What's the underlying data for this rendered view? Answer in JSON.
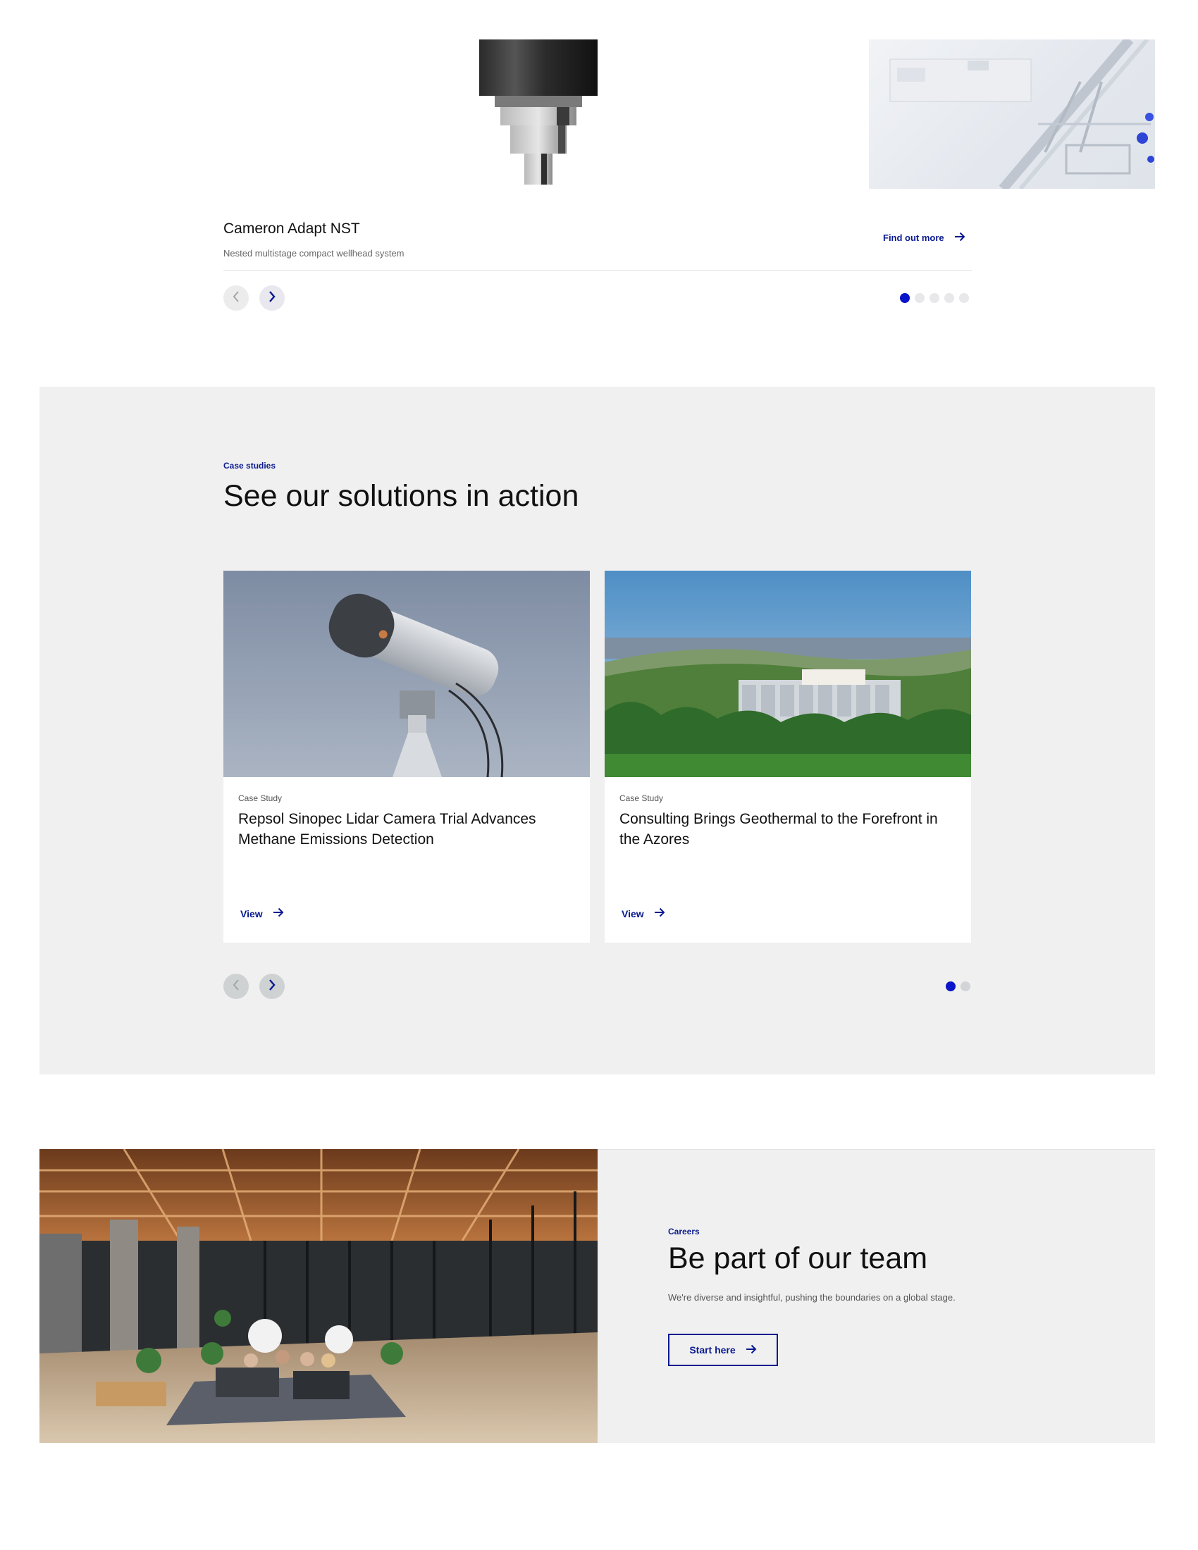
{
  "product_carousel": {
    "title": "Cameron Adapt NST",
    "subtitle": "Nested multistage compact wellhead system",
    "cta_label": "Find out more",
    "slide_count": 5,
    "active_slide": 1
  },
  "case_studies": {
    "eyebrow": "Case studies",
    "heading": "See our solutions in action",
    "cards": [
      {
        "tag": "Case Study",
        "title": "Repsol Sinopec Lidar Camera Trial Advances Methane Emissions Detection",
        "link_label": "View"
      },
      {
        "tag": "Case Study",
        "title": "Consulting Brings Geothermal to the Forefront in the Azores",
        "link_label": "View"
      }
    ],
    "slide_count": 2,
    "active_slide": 1
  },
  "careers": {
    "eyebrow": "Careers",
    "heading": "Be part of our team",
    "body": "We're diverse and insightful, pushing the boundaries on a global stage.",
    "cta_label": "Start here"
  },
  "icons": {
    "prev": "chevron-left-icon",
    "next": "chevron-right-icon",
    "arrow": "arrow-right-icon"
  },
  "colors": {
    "accent": "#0a1a8f",
    "dot_active": "#0a14c8",
    "section_bg": "#f0f0f0"
  }
}
